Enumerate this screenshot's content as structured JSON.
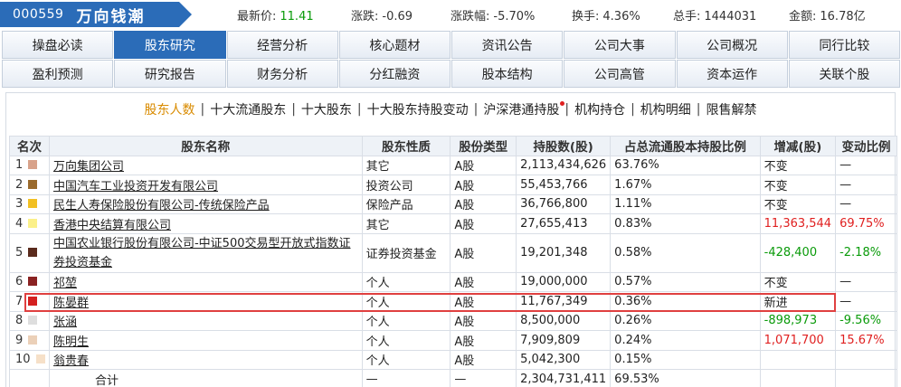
{
  "header": {
    "code": "000559",
    "name": "万向钱潮",
    "quotes": [
      {
        "label": "最新价:",
        "value": "11.41"
      },
      {
        "label": "涨跌:",
        "value": "-0.69"
      },
      {
        "label": "涨跌幅:",
        "value": "-5.70%"
      },
      {
        "label": "换手:",
        "value": "4.36%"
      },
      {
        "label": "总手:",
        "value": "1444031"
      },
      {
        "label": "金额:",
        "value": "16.78亿"
      }
    ]
  },
  "nav": {
    "row1": [
      "操盘必读",
      "股东研究",
      "经营分析",
      "核心题材",
      "资讯公告",
      "公司大事",
      "公司概况",
      "同行比较"
    ],
    "row2": [
      "盈利预测",
      "研究报告",
      "财务分析",
      "分红融资",
      "股本结构",
      "公司高管",
      "资本运作",
      "关联个股"
    ]
  },
  "subtabs": [
    "股东人数",
    "十大流通股东",
    "十大股东",
    "十大股东持股变动",
    "沪深港通持股",
    "机构持仓",
    "机构明细",
    "限售解禁"
  ],
  "table": {
    "headers": [
      "名次",
      "股东名称",
      "股东性质",
      "股份类型",
      "持股数(股)",
      "占总流通股本持股比例",
      "增减(股)",
      "变动比例"
    ],
    "rows": [
      {
        "rank": "1",
        "name": "万向集团公司",
        "nature": "其它",
        "type": "A股",
        "shares": "2,113,434,626",
        "ratio": "63.76%",
        "change": "不变",
        "pct": "—",
        "color": "#d8a28a"
      },
      {
        "rank": "2",
        "name": "中国汽车工业投资开发有限公司",
        "nature": "投资公司",
        "type": "A股",
        "shares": "55,453,766",
        "ratio": "1.67%",
        "change": "不变",
        "pct": "—",
        "color": "#9a6a2c"
      },
      {
        "rank": "3",
        "name": "民生人寿保险股份有限公司-传统保险产品",
        "nature": "保险产品",
        "type": "A股",
        "shares": "36,766,800",
        "ratio": "1.11%",
        "change": "不变",
        "pct": "—",
        "color": "#f2c023"
      },
      {
        "rank": "4",
        "name": "香港中央结算有限公司",
        "nature": "其它",
        "type": "A股",
        "shares": "27,655,413",
        "ratio": "0.83%",
        "change": "11,363,544",
        "pct": "69.75%",
        "color": "#fbf08a"
      },
      {
        "rank": "5",
        "name": "中国农业银行股份有限公司-中证500交易型开放式指数证券投资基金",
        "nature": "证券投资基金",
        "type": "A股",
        "shares": "19,201,348",
        "ratio": "0.58%",
        "change": "-428,400",
        "pct": "-2.18%",
        "color": "#5a2a1c"
      },
      {
        "rank": "6",
        "name": "祁堃",
        "nature": "个人",
        "type": "A股",
        "shares": "19,000,000",
        "ratio": "0.57%",
        "change": "不变",
        "pct": "—",
        "color": "#8a2222"
      },
      {
        "rank": "7",
        "name": "陈晏群",
        "nature": "个人",
        "type": "A股",
        "shares": "11,767,349",
        "ratio": "0.36%",
        "change": "新进",
        "pct": "—",
        "color": "#d42020"
      },
      {
        "rank": "8",
        "name": "张涵",
        "nature": "个人",
        "type": "A股",
        "shares": "8,500,000",
        "ratio": "0.26%",
        "change": "-898,973",
        "pct": "-9.56%",
        "color": "#dedede"
      },
      {
        "rank": "9",
        "name": "陈明生",
        "nature": "个人",
        "type": "A股",
        "shares": "7,909,809",
        "ratio": "0.24%",
        "change": "1,071,700",
        "pct": "15.67%",
        "color": "#ebd0b8"
      },
      {
        "rank": "10",
        "name": "翁贵春",
        "nature": "个人",
        "type": "A股",
        "shares": "5,042,300",
        "ratio": "0.15%",
        "change": "",
        "pct": "",
        "color": "#f6e0c8"
      }
    ],
    "total": {
      "label": "合计",
      "nature": "—",
      "type": "—",
      "shares": "2,304,731,411",
      "ratio": "69.53%"
    }
  }
}
